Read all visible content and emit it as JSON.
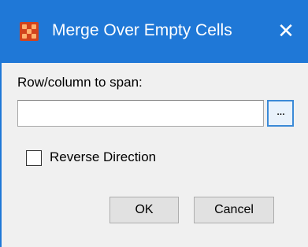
{
  "window": {
    "title": "Merge Over Empty Cells",
    "close_label": "✕",
    "icon": "app-grid-icon",
    "accent_color": "#1f78d7",
    "icon_color": "#d2431d"
  },
  "form": {
    "span_label": "Row/column to span:",
    "span_value": "",
    "browse_label": "...",
    "reverse_label": "Reverse Direction",
    "reverse_checked": false
  },
  "buttons": {
    "ok_label": "OK",
    "cancel_label": "Cancel"
  }
}
